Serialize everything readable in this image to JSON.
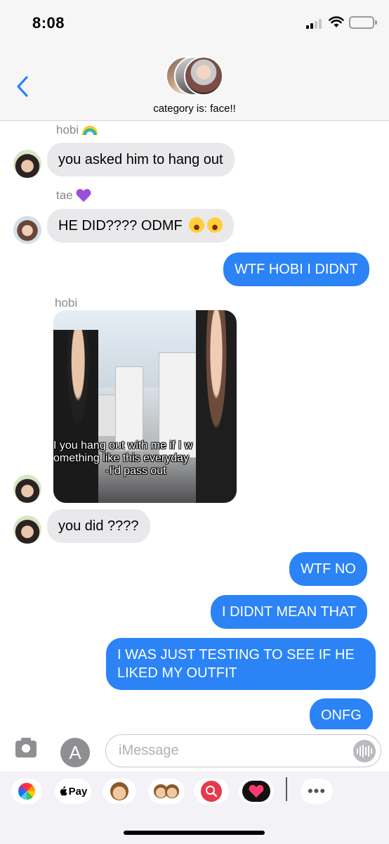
{
  "status_bar": {
    "time": "8:08"
  },
  "header": {
    "back_icon": "chevron-left-icon",
    "group_name": "category is: face!!"
  },
  "messages": [
    {
      "type": "sender",
      "name": "hobi",
      "emoji": "rainbow"
    },
    {
      "type": "incoming",
      "sender": "hobi",
      "text": "you asked him to hang out"
    },
    {
      "type": "sender",
      "name": "tae",
      "emoji": "purple-heart"
    },
    {
      "type": "incoming",
      "sender": "tae",
      "text": "HE DID???? ODMF",
      "emoji": "laughing-crying x2"
    },
    {
      "type": "outgoing",
      "text": "WTF HOBI I DIDNT"
    },
    {
      "type": "sender",
      "name": "hobi"
    },
    {
      "type": "image",
      "sender": "hobi",
      "caption_lines": [
        "I you hang out with me if I w",
        "omething like this everyday",
        "-I'd pass out"
      ]
    },
    {
      "type": "incoming",
      "sender": "hobi",
      "text": "you did ????"
    },
    {
      "type": "outgoing",
      "text": "WTF NO"
    },
    {
      "type": "outgoing",
      "text": "I DIDNT MEAN THAT"
    },
    {
      "type": "outgoing",
      "text": "I WAS JUST TESTING TO SEE IF HE LIKED MY OUTFIT"
    },
    {
      "type": "outgoing",
      "text": "ONFG"
    }
  ],
  "input": {
    "placeholder": "iMessage"
  },
  "drawer": {
    "apple_pay_label": "Pay",
    "apps": [
      "photos-icon",
      "apple-pay-icon",
      "monkey-memoji-icon",
      "memoji-stickers-icon",
      "search-images-icon",
      "digital-touch-icon",
      "more-icon"
    ]
  },
  "colors": {
    "outgoing_bubble": "#2b83f6",
    "incoming_bubble": "#e9e9eb",
    "sender_label": "#8a8a8e"
  }
}
